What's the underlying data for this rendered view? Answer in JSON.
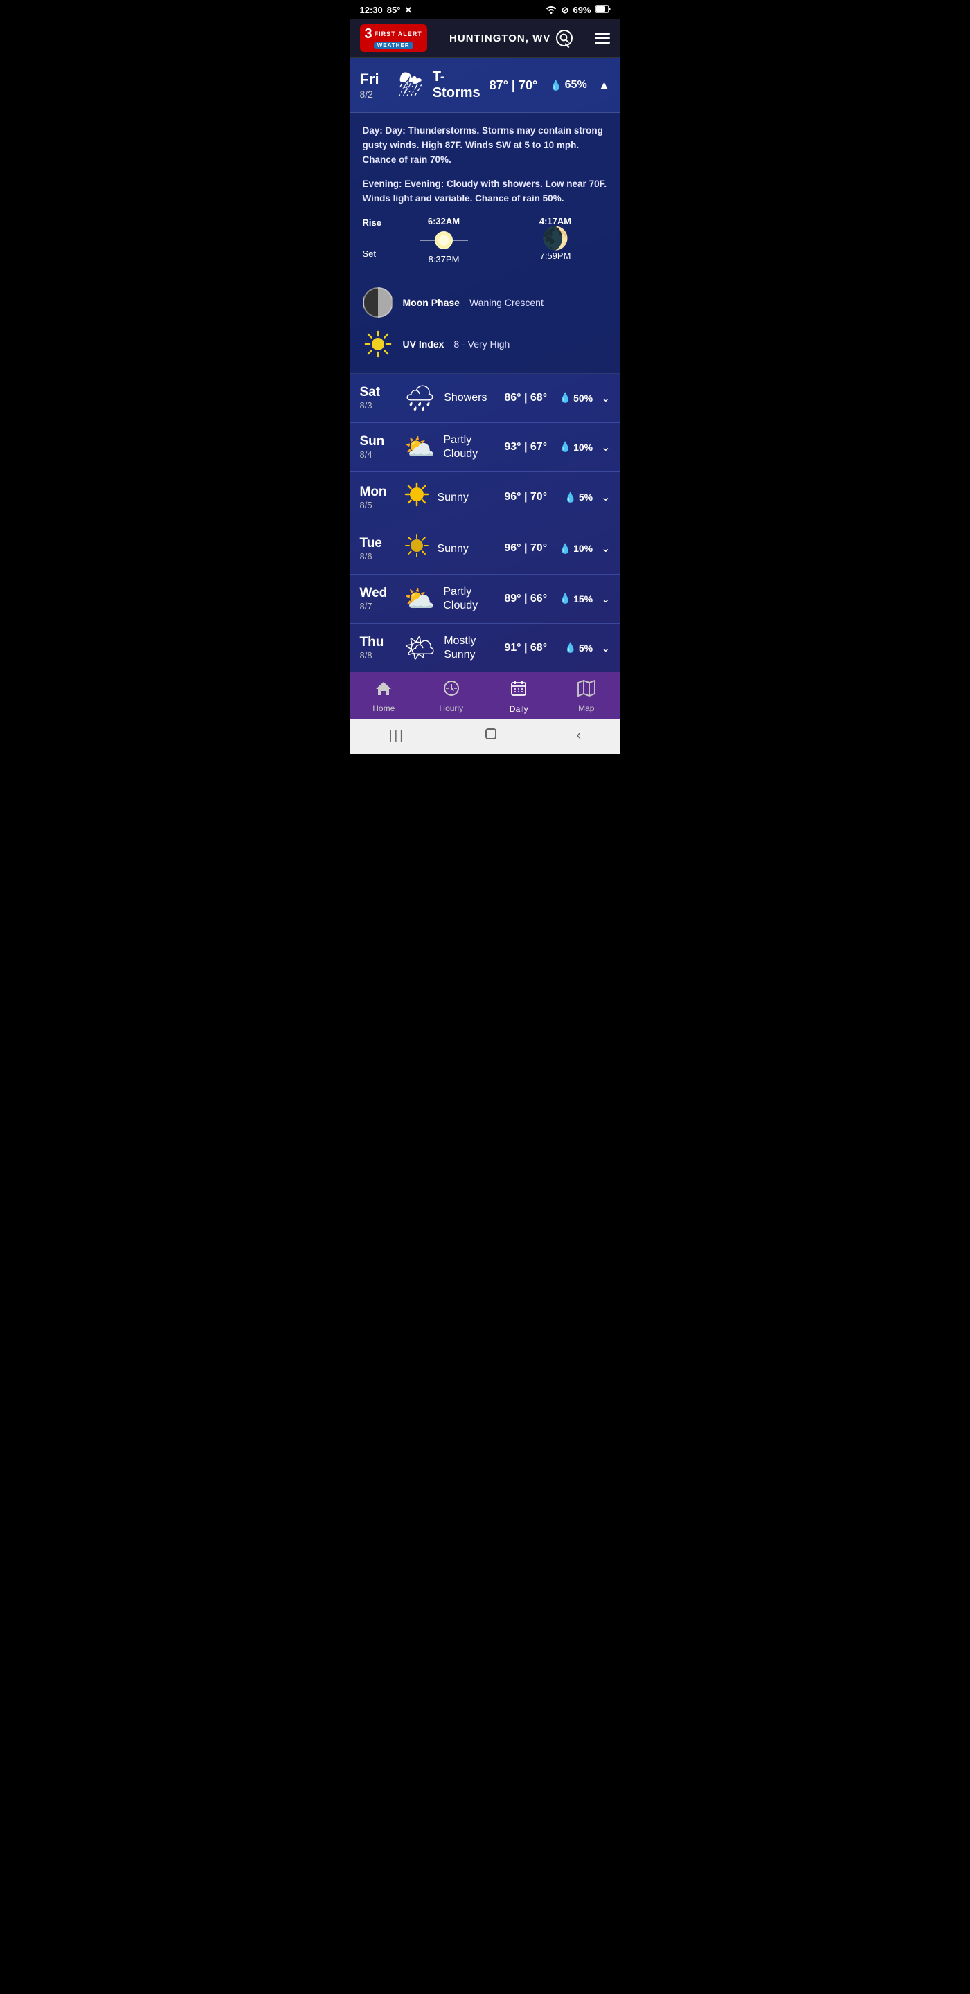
{
  "statusBar": {
    "time": "12:30",
    "temp": "85°",
    "battery": "69%"
  },
  "header": {
    "city": "HUNTINGTON, WV",
    "logo": {
      "channel": "3",
      "firstLine": "FIRST ALERT",
      "weather": "WEATHER"
    },
    "searchLabel": "search",
    "menuLabel": "menu"
  },
  "currentDay": {
    "dayName": "Fri",
    "dayNum": "8/2",
    "condition": "T-Storms",
    "highTemp": "87°",
    "lowTemp": "70°",
    "separator": "|",
    "rainChance": "65%",
    "icon": "⛈",
    "detail": {
      "dayDesc": "Day: Thunderstorms. Storms may contain strong gusty winds. High 87F. Winds SW at 5 to 10 mph. Chance of rain 70%.",
      "eveningDesc": "Evening: Cloudy with showers. Low near 70F. Winds light and variable. Chance of rain 50%.",
      "sunRise": "6:32AM",
      "sunSet": "8:37PM",
      "moonRise": "4:17AM",
      "moonSet": "7:59PM",
      "riseLabel": "Rise",
      "setLabel": "Set",
      "moonPhaseLabel": "Moon Phase",
      "moonPhaseValue": "Waning Crescent",
      "uvIndexLabel": "UV Index",
      "uvIndexValue": "8 - Very High"
    }
  },
  "forecast": [
    {
      "dayName": "Sat",
      "dayNum": "8/3",
      "condition": "Showers",
      "highTemp": "86°",
      "lowTemp": "68°",
      "rainChance": "50%",
      "icon": "🌧"
    },
    {
      "dayName": "Sun",
      "dayNum": "8/4",
      "condition": "Partly Cloudy",
      "highTemp": "93°",
      "lowTemp": "67°",
      "rainChance": "10%",
      "icon": "⛅"
    },
    {
      "dayName": "Mon",
      "dayNum": "8/5",
      "condition": "Sunny",
      "highTemp": "96°",
      "lowTemp": "70°",
      "rainChance": "5%",
      "icon": "☀️"
    },
    {
      "dayName": "Tue",
      "dayNum": "8/6",
      "condition": "Sunny",
      "highTemp": "96°",
      "lowTemp": "70°",
      "rainChance": "10%",
      "icon": "☀️"
    },
    {
      "dayName": "Wed",
      "dayNum": "8/7",
      "condition": "Partly Cloudy",
      "highTemp": "89°",
      "lowTemp": "66°",
      "rainChance": "15%",
      "icon": "⛅"
    },
    {
      "dayName": "Thu",
      "dayNum": "8/8",
      "condition": "Mostly Sunny",
      "highTemp": "91°",
      "lowTemp": "68°",
      "rainChance": "5%",
      "icon": "🌤"
    }
  ],
  "bottomNav": {
    "items": [
      {
        "id": "home",
        "label": "Home",
        "icon": "🏠",
        "active": false
      },
      {
        "id": "hourly",
        "label": "Hourly",
        "icon": "◀",
        "active": false
      },
      {
        "id": "daily",
        "label": "Daily",
        "icon": "📅",
        "active": true
      },
      {
        "id": "map",
        "label": "Map",
        "icon": "🗺",
        "active": false
      }
    ]
  },
  "sysNav": {
    "backIcon": "❮",
    "homeIcon": "⬜",
    "menuIcon": "|||"
  }
}
